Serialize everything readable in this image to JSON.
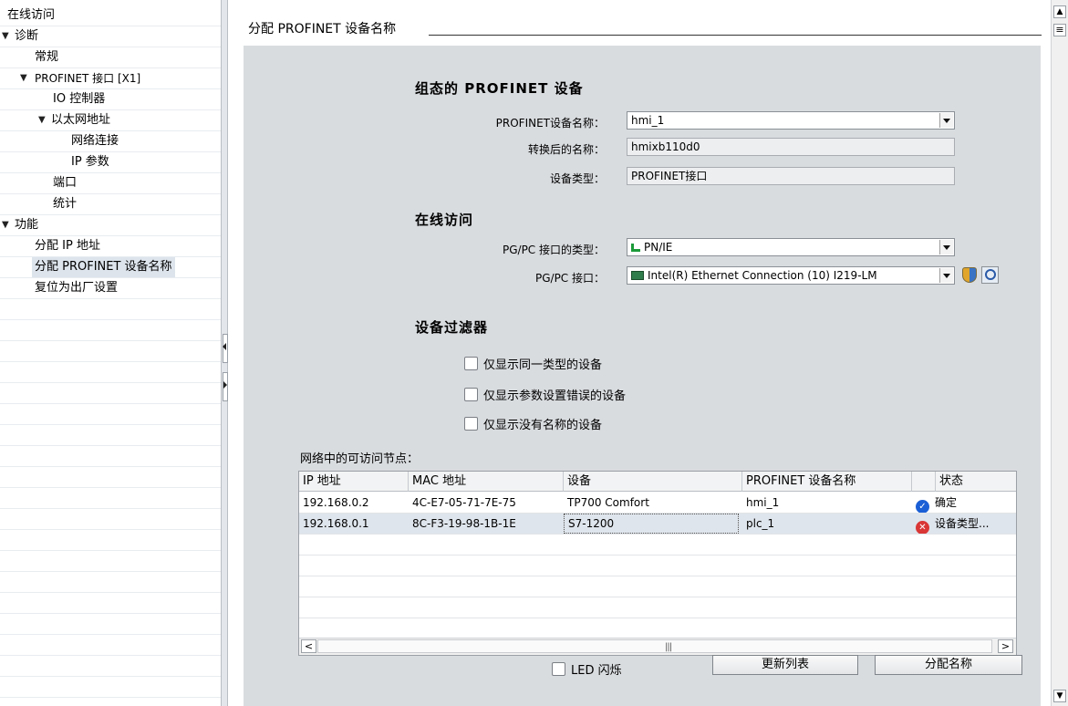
{
  "nav": {
    "items": [
      {
        "label": "在线访问",
        "toggle": ""
      },
      {
        "label": "诊断",
        "toggle": "▼"
      },
      {
        "label": "常规",
        "toggle": ""
      },
      {
        "label": "PROFINET 接口 [X1]",
        "toggle": "▼"
      },
      {
        "label": "IO 控制器",
        "toggle": ""
      },
      {
        "label": "以太网地址",
        "toggle": "▼"
      },
      {
        "label": "网络连接",
        "toggle": ""
      },
      {
        "label": "IP 参数",
        "toggle": ""
      },
      {
        "label": "端口",
        "toggle": ""
      },
      {
        "label": "统计",
        "toggle": ""
      },
      {
        "label": "功能",
        "toggle": "▼"
      },
      {
        "label": "分配 IP 地址",
        "toggle": ""
      },
      {
        "label": "分配 PROFINET 设备名称",
        "toggle": ""
      },
      {
        "label": "复位为出厂设置",
        "toggle": ""
      }
    ],
    "selected": "分配 PROFINET 设备名称"
  },
  "section": {
    "title": "分配 PROFINET 设备名称"
  },
  "configured": {
    "heading": "组态的 PROFINET 设备",
    "device_name_label": "PROFINET设备名称：",
    "device_name_value": "hmi_1",
    "converted_label": "转换后的名称：",
    "converted_value": "hmixb110d0",
    "device_type_label": "设备类型：",
    "device_type_value": "PROFINET接口"
  },
  "online": {
    "heading": "在线访问",
    "if_type_label": "PG/PC 接口的类型：",
    "if_type_value": "PN/IE",
    "if_label": "PG/PC 接口：",
    "if_value": "Intel(R) Ethernet Connection (10) I219-LM"
  },
  "filter": {
    "heading": "设备过滤器",
    "options": [
      "仅显示同一类型的设备",
      "仅显示参数设置错误的设备",
      "仅显示没有名称的设备"
    ]
  },
  "nodes": {
    "title": "网络中的可访问节点：",
    "columns": [
      "IP 地址",
      "MAC 地址",
      "设备",
      "PROFINET 设备名称",
      "状态"
    ],
    "rows": [
      {
        "ip": "192.168.0.2",
        "mac": "4C-E7-05-71-7E-75",
        "device": "TP700 Comfort",
        "name": "hmi_1",
        "status": "确定",
        "status_type": "ok"
      },
      {
        "ip": "192.168.0.1",
        "mac": "8C-F3-19-98-1B-1E",
        "device": "S7-1200",
        "name": "plc_1",
        "status": "设备类型...",
        "status_type": "error"
      }
    ]
  },
  "actions": {
    "led_label": "LED 闪烁",
    "update_label": "更新列表",
    "assign_label": "分配名称"
  },
  "colors": {
    "ok": "#1b5fd6",
    "error": "#d93636",
    "panel": "#d9dcdf",
    "selected_row": "#dfe5ec"
  }
}
